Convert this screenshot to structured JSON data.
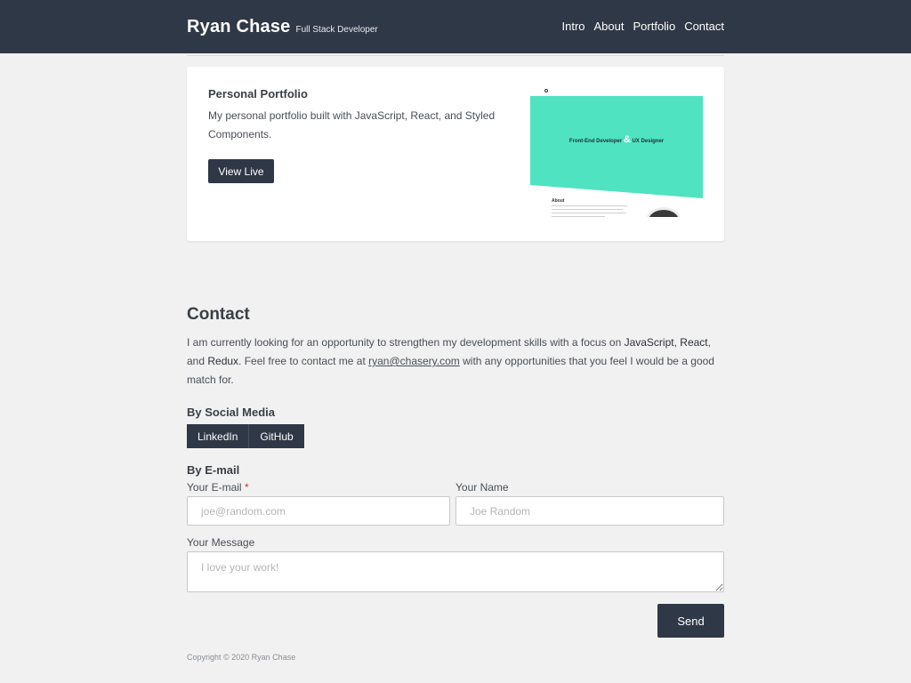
{
  "header": {
    "name": "Ryan Chase",
    "subtitle": "Full Stack Developer",
    "nav": [
      "Intro",
      "About",
      "Portfolio",
      "Contact"
    ]
  },
  "project": {
    "title": "Personal Portfolio",
    "description": "My personal portfolio built with JavaScript, React, and Styled Components.",
    "button": "View Live",
    "thumbnail": {
      "hero_text_left": "Front-End Developer",
      "hero_amp": "&",
      "hero_text_right": "UX Designer",
      "about_heading": "About"
    }
  },
  "contact": {
    "title": "Contact",
    "text_1": "I am currently looking for an opportunity to strengthen my development skills with a focus on ",
    "tech_1": "JavaScript",
    "sep_1": ", ",
    "tech_2": "React",
    "sep_2": ", and ",
    "tech_3": "Redux",
    "text_2": ". Feel free to contact me at ",
    "email": "ryan@chasery.com",
    "text_3": " with any opportunities that you feel I would be a good match for.",
    "social_label": "By Social Media",
    "social_buttons": [
      "LinkedIn",
      "GitHub"
    ],
    "email_label": "By E-mail",
    "form": {
      "email_label": "Your E-mail",
      "required_mark": "*",
      "email_placeholder": "joe@random.com",
      "name_label": "Your Name",
      "name_placeholder": "Joe Random",
      "message_label": "Your Message",
      "message_placeholder": "I love your work!",
      "send": "Send"
    }
  },
  "footer": {
    "copyright": "Copyright © 2020 Ryan Chase"
  },
  "colors": {
    "header_bg": "#2f3846",
    "page_bg": "#f1f1f1",
    "hero_accent": "#4fe3c1"
  }
}
